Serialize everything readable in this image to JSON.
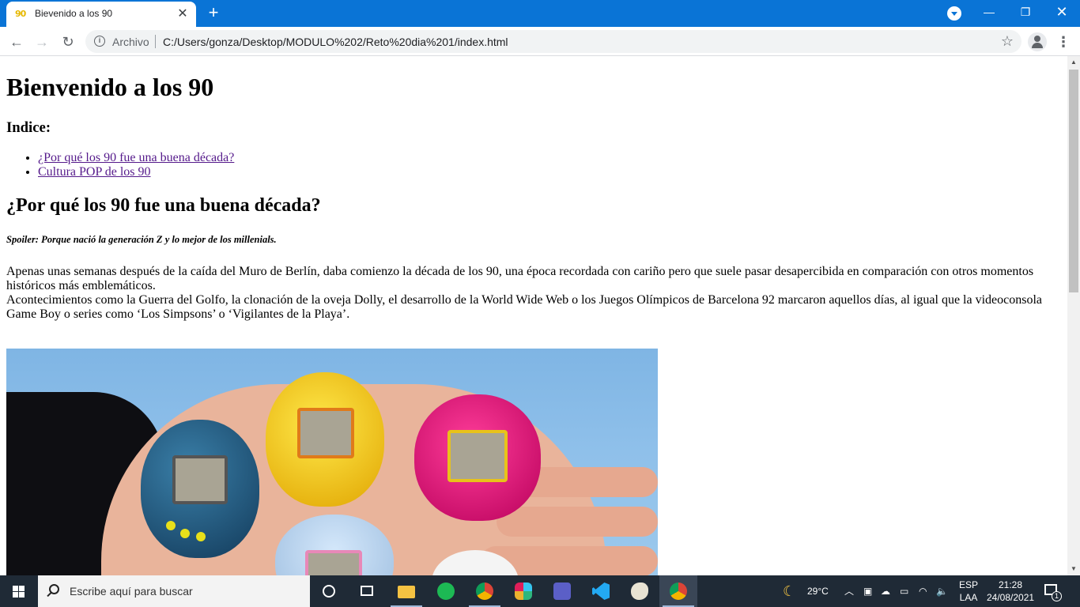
{
  "browser": {
    "tab_title": "Bievenido a los 90",
    "tab_favicon": "90",
    "new_tab_icon": "plus-icon",
    "omnibox": {
      "scheme_label": "Archivo",
      "url": "C:/Users/gonza/Desktop/MODULO%202/Reto%20dia%201/index.html"
    }
  },
  "page": {
    "title": "Bienvenido a los 90",
    "index_heading": "Indice:",
    "index_links": [
      "¿Por qué los 90 fue una buena década?",
      "Cultura POP de los 90"
    ],
    "section_heading": "¿Por qué los 90 fue una buena década?",
    "spoiler": "Spoiler: Porque nació la generación Z y lo mejor de los millenials.",
    "paragraph_1": "Apenas unas semanas después de la caída del Muro de Berlín, daba comienzo la década de los 90, una época recordada con cariño pero que suele pasar desapercibida en comparación con otros momentos históricos más emblemáticos.",
    "paragraph_2": "Acontecimientos como la Guerra del Golfo, la clonación de la oveja Dolly, el desarrollo de la World Wide Web o los Juegos Olímpicos de Barcelona 92 marcaron aquellos días, al igual que la videoconsola Game Boy o series como ‘Los Simpsons’ o ‘Vigilantes de la Playa’."
  },
  "taskbar": {
    "search_placeholder": "Escribe aquí para buscar",
    "weather": "29°C",
    "lang_top": "ESP",
    "lang_bottom": "LAA",
    "time": "21:28",
    "date": "24/08/2021",
    "notification_count": "1",
    "pinned_apps": [
      "task-view",
      "file-explorer",
      "spotify",
      "chrome",
      "slack",
      "teams",
      "vscode",
      "paint",
      "chrome-active"
    ]
  },
  "colors": {
    "titlebar": "#0a74d6",
    "visited_link": "#551a8b",
    "taskbar": "#1f2a36"
  }
}
